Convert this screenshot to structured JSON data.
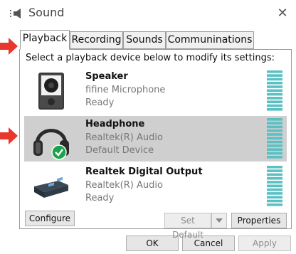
{
  "window": {
    "title": "Sound",
    "title_icon": "speaker-icon",
    "close_glyph": "✕"
  },
  "tabs": [
    {
      "label": "Playback",
      "active": true
    },
    {
      "label": "Recording",
      "active": false
    },
    {
      "label": "Sounds",
      "active": false
    },
    {
      "label": "Communinations",
      "active": false
    }
  ],
  "instruction": "Select a playback device below to modify its settings:",
  "devices": [
    {
      "name": "Speaker",
      "subtitle": "fifine Microphone",
      "status": "Ready",
      "icon": "speaker-icon",
      "selected": false
    },
    {
      "name": "Headphone",
      "subtitle": "Realtek(R) Audio",
      "status": "Default Device",
      "icon": "headphone-icon",
      "selected": true,
      "default_badge": "check-badge-icon"
    },
    {
      "name": "Realtek Digital Output",
      "subtitle": "Realtek(R) Audio",
      "status": "Ready",
      "icon": "digital-output-icon",
      "selected": false
    }
  ],
  "buttons": {
    "configure": "Configure",
    "set_default": "Set Default",
    "properties": "Properties",
    "ok": "OK",
    "cancel": "Cancel",
    "apply": "Apply"
  },
  "colors": {
    "meter": "#5bc0c3",
    "arrow": "#e8372c",
    "selected_row": "#cfcfcf",
    "check_badge": "#1aa34a"
  }
}
